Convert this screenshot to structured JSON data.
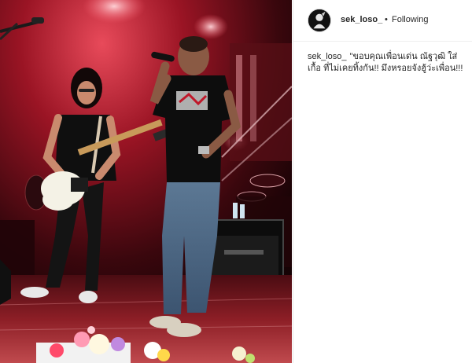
{
  "post": {
    "username": "sek_loso_",
    "separator": "•",
    "follow_status": "Following",
    "caption_user": "sek_loso_",
    "caption_text": "\"ขอบคุณเพื่อนเด่น ณัฐวุฒิ ใส่เกื้อ ที่ไม่เคยทิ้งกัน!! มึงหรอยจังฮู้ว่ะเพื่อน!!!"
  },
  "icons": {
    "avatar": "profile-avatar-icon"
  },
  "colors": {
    "text": "#262626",
    "divider": "#efefef",
    "stage_red": "#c0182a"
  }
}
